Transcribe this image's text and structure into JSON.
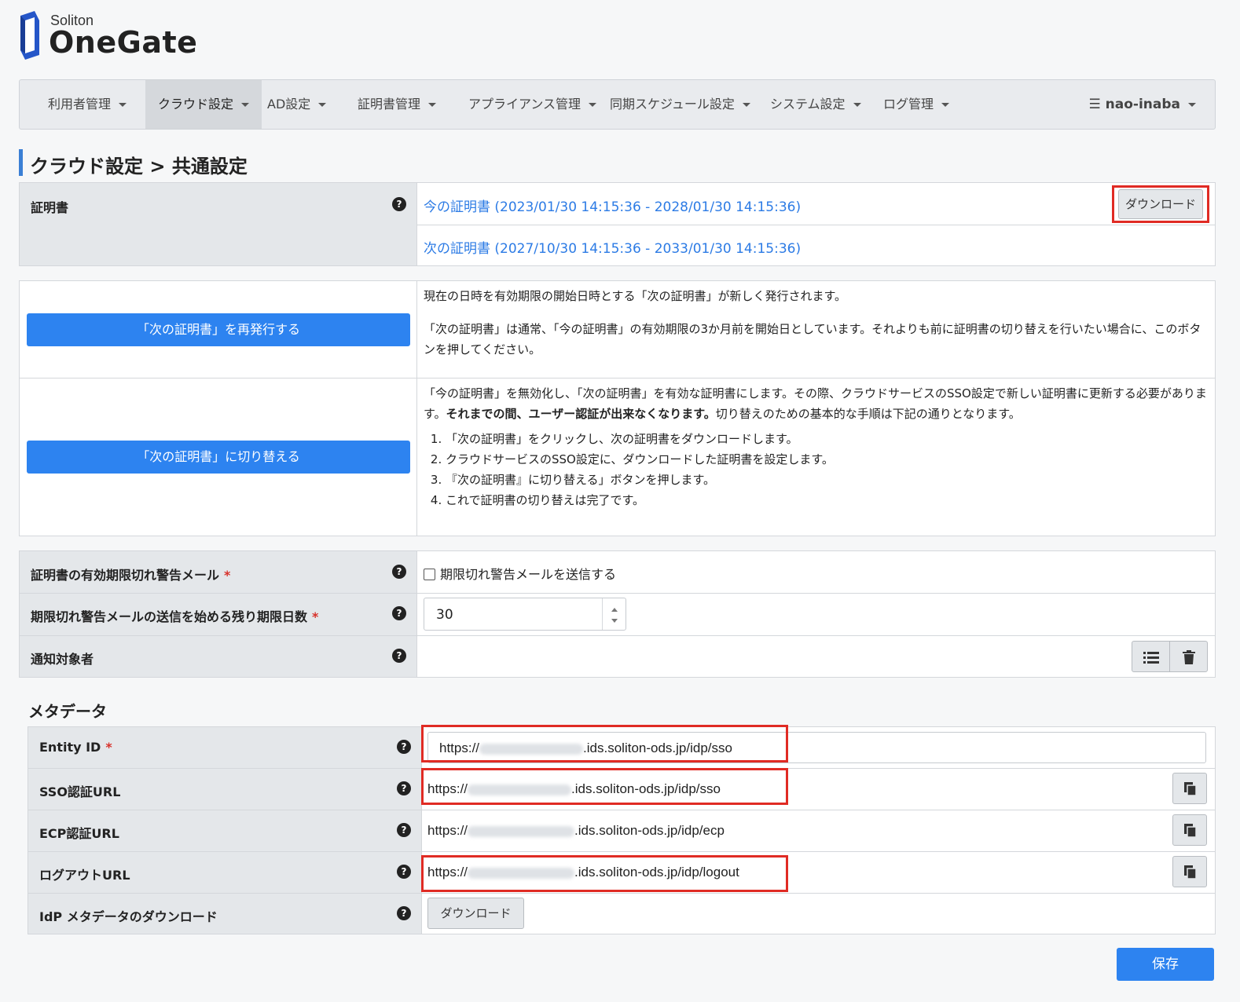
{
  "brand": {
    "small": "Soliton",
    "name": "OneGate"
  },
  "nav": {
    "items": [
      {
        "label": "利用者管理"
      },
      {
        "label": "クラウド設定"
      },
      {
        "label": "AD設定"
      },
      {
        "label": "証明書管理"
      },
      {
        "label": "アプライアンス管理"
      },
      {
        "label": "同期スケジュール設定"
      },
      {
        "label": "システム設定"
      },
      {
        "label": "ログ管理"
      }
    ],
    "user": "☰ nao-inaba"
  },
  "page": {
    "title": "クラウド設定 > 共通設定"
  },
  "certificate": {
    "label": "証明書",
    "current": "今の証明書 (2023/01/30 14:15:36 - 2028/01/30 14:15:36)",
    "next": "次の証明書 (2027/10/30 14:15:36 - 2033/01/30 14:15:36)",
    "download": "ダウンロード"
  },
  "reissue": {
    "button": "「次の証明書」を再発行する",
    "p1": "現在の日時を有効期限の開始日時とする「次の証明書」が新しく発行されます。",
    "p2": "「次の証明書」は通常、「今の証明書」の有効期限の3か月前を開始日としています。それよりも前に証明書の切り替えを行いたい場合に、このボタンを押してください。"
  },
  "switch": {
    "button": "「次の証明書」に切り替える",
    "p1a": "「今の証明書」を無効化し、「次の証明書」を有効な証明書にします。その際、クラウドサービスのSSO設定で新しい証明書に更新する必要があります。",
    "p1b": "それまでの間、ユーザー認証が出来なくなります。",
    "p1c": "切り替えのための基本的な手順は下記の通りとなります。",
    "steps": [
      "「次の証明書」をクリックし、次の証明書をダウンロードします。",
      "クラウドサービスのSSO設定に、ダウンロードした証明書を設定します。",
      "『次の証明書』に切り替える」ボタンを押します。",
      "これで証明書の切り替えは完了です。"
    ]
  },
  "warning": {
    "mail_label": "証明書の有効期限切れ警告メール",
    "mail_checkbox": "期限切れ警告メールを送信する",
    "days_label": "期限切れ警告メールの送信を始める残り期限日数",
    "days_value": "30",
    "recipients_label": "通知対象者",
    "required_mark": "*"
  },
  "metadata": {
    "heading": "メタデータ",
    "entity_label": "Entity ID",
    "entity_prefix": "https://",
    "entity_suffix": ".ids.soliton-ods.jp/idp/sso",
    "sso_label": "SSO認証URL",
    "sso_prefix": "https://",
    "sso_suffix": ".ids.soliton-ods.jp/idp/sso",
    "ecp_label": "ECP認証URL",
    "ecp_prefix": "https://",
    "ecp_suffix": ".ids.soliton-ods.jp/idp/ecp",
    "logout_label": "ログアウトURL",
    "logout_prefix": "https://",
    "logout_suffix": ".ids.soliton-ods.jp/idp/logout",
    "idp_label": "IdP メタデータのダウンロード",
    "idp_download": "ダウンロード",
    "required_mark": "*"
  },
  "footer": {
    "save": "保存"
  },
  "colors": {
    "accent": "#2d83f0",
    "link": "#2c7be5",
    "highlight": "#e02b24",
    "label_bg": "#e4e7ea"
  }
}
